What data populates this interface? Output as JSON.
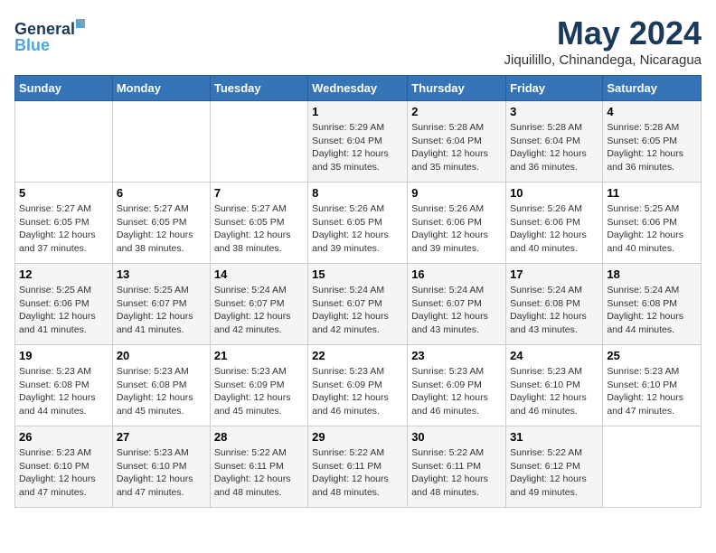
{
  "logo": {
    "part1": "General",
    "part2": "Blue"
  },
  "title": "May 2024",
  "location": "Jiquilillo, Chinandega, Nicaragua",
  "weekdays": [
    "Sunday",
    "Monday",
    "Tuesday",
    "Wednesday",
    "Thursday",
    "Friday",
    "Saturday"
  ],
  "weeks": [
    [
      {
        "day": "",
        "sunrise": "",
        "sunset": "",
        "daylight": ""
      },
      {
        "day": "",
        "sunrise": "",
        "sunset": "",
        "daylight": ""
      },
      {
        "day": "",
        "sunrise": "",
        "sunset": "",
        "daylight": ""
      },
      {
        "day": "1",
        "sunrise": "Sunrise: 5:29 AM",
        "sunset": "Sunset: 6:04 PM",
        "daylight": "Daylight: 12 hours and 35 minutes."
      },
      {
        "day": "2",
        "sunrise": "Sunrise: 5:28 AM",
        "sunset": "Sunset: 6:04 PM",
        "daylight": "Daylight: 12 hours and 35 minutes."
      },
      {
        "day": "3",
        "sunrise": "Sunrise: 5:28 AM",
        "sunset": "Sunset: 6:04 PM",
        "daylight": "Daylight: 12 hours and 36 minutes."
      },
      {
        "day": "4",
        "sunrise": "Sunrise: 5:28 AM",
        "sunset": "Sunset: 6:05 PM",
        "daylight": "Daylight: 12 hours and 36 minutes."
      }
    ],
    [
      {
        "day": "5",
        "sunrise": "Sunrise: 5:27 AM",
        "sunset": "Sunset: 6:05 PM",
        "daylight": "Daylight: 12 hours and 37 minutes."
      },
      {
        "day": "6",
        "sunrise": "Sunrise: 5:27 AM",
        "sunset": "Sunset: 6:05 PM",
        "daylight": "Daylight: 12 hours and 38 minutes."
      },
      {
        "day": "7",
        "sunrise": "Sunrise: 5:27 AM",
        "sunset": "Sunset: 6:05 PM",
        "daylight": "Daylight: 12 hours and 38 minutes."
      },
      {
        "day": "8",
        "sunrise": "Sunrise: 5:26 AM",
        "sunset": "Sunset: 6:05 PM",
        "daylight": "Daylight: 12 hours and 39 minutes."
      },
      {
        "day": "9",
        "sunrise": "Sunrise: 5:26 AM",
        "sunset": "Sunset: 6:06 PM",
        "daylight": "Daylight: 12 hours and 39 minutes."
      },
      {
        "day": "10",
        "sunrise": "Sunrise: 5:26 AM",
        "sunset": "Sunset: 6:06 PM",
        "daylight": "Daylight: 12 hours and 40 minutes."
      },
      {
        "day": "11",
        "sunrise": "Sunrise: 5:25 AM",
        "sunset": "Sunset: 6:06 PM",
        "daylight": "Daylight: 12 hours and 40 minutes."
      }
    ],
    [
      {
        "day": "12",
        "sunrise": "Sunrise: 5:25 AM",
        "sunset": "Sunset: 6:06 PM",
        "daylight": "Daylight: 12 hours and 41 minutes."
      },
      {
        "day": "13",
        "sunrise": "Sunrise: 5:25 AM",
        "sunset": "Sunset: 6:07 PM",
        "daylight": "Daylight: 12 hours and 41 minutes."
      },
      {
        "day": "14",
        "sunrise": "Sunrise: 5:24 AM",
        "sunset": "Sunset: 6:07 PM",
        "daylight": "Daylight: 12 hours and 42 minutes."
      },
      {
        "day": "15",
        "sunrise": "Sunrise: 5:24 AM",
        "sunset": "Sunset: 6:07 PM",
        "daylight": "Daylight: 12 hours and 42 minutes."
      },
      {
        "day": "16",
        "sunrise": "Sunrise: 5:24 AM",
        "sunset": "Sunset: 6:07 PM",
        "daylight": "Daylight: 12 hours and 43 minutes."
      },
      {
        "day": "17",
        "sunrise": "Sunrise: 5:24 AM",
        "sunset": "Sunset: 6:08 PM",
        "daylight": "Daylight: 12 hours and 43 minutes."
      },
      {
        "day": "18",
        "sunrise": "Sunrise: 5:24 AM",
        "sunset": "Sunset: 6:08 PM",
        "daylight": "Daylight: 12 hours and 44 minutes."
      }
    ],
    [
      {
        "day": "19",
        "sunrise": "Sunrise: 5:23 AM",
        "sunset": "Sunset: 6:08 PM",
        "daylight": "Daylight: 12 hours and 44 minutes."
      },
      {
        "day": "20",
        "sunrise": "Sunrise: 5:23 AM",
        "sunset": "Sunset: 6:08 PM",
        "daylight": "Daylight: 12 hours and 45 minutes."
      },
      {
        "day": "21",
        "sunrise": "Sunrise: 5:23 AM",
        "sunset": "Sunset: 6:09 PM",
        "daylight": "Daylight: 12 hours and 45 minutes."
      },
      {
        "day": "22",
        "sunrise": "Sunrise: 5:23 AM",
        "sunset": "Sunset: 6:09 PM",
        "daylight": "Daylight: 12 hours and 46 minutes."
      },
      {
        "day": "23",
        "sunrise": "Sunrise: 5:23 AM",
        "sunset": "Sunset: 6:09 PM",
        "daylight": "Daylight: 12 hours and 46 minutes."
      },
      {
        "day": "24",
        "sunrise": "Sunrise: 5:23 AM",
        "sunset": "Sunset: 6:10 PM",
        "daylight": "Daylight: 12 hours and 46 minutes."
      },
      {
        "day": "25",
        "sunrise": "Sunrise: 5:23 AM",
        "sunset": "Sunset: 6:10 PM",
        "daylight": "Daylight: 12 hours and 47 minutes."
      }
    ],
    [
      {
        "day": "26",
        "sunrise": "Sunrise: 5:23 AM",
        "sunset": "Sunset: 6:10 PM",
        "daylight": "Daylight: 12 hours and 47 minutes."
      },
      {
        "day": "27",
        "sunrise": "Sunrise: 5:23 AM",
        "sunset": "Sunset: 6:10 PM",
        "daylight": "Daylight: 12 hours and 47 minutes."
      },
      {
        "day": "28",
        "sunrise": "Sunrise: 5:22 AM",
        "sunset": "Sunset: 6:11 PM",
        "daylight": "Daylight: 12 hours and 48 minutes."
      },
      {
        "day": "29",
        "sunrise": "Sunrise: 5:22 AM",
        "sunset": "Sunset: 6:11 PM",
        "daylight": "Daylight: 12 hours and 48 minutes."
      },
      {
        "day": "30",
        "sunrise": "Sunrise: 5:22 AM",
        "sunset": "Sunset: 6:11 PM",
        "daylight": "Daylight: 12 hours and 48 minutes."
      },
      {
        "day": "31",
        "sunrise": "Sunrise: 5:22 AM",
        "sunset": "Sunset: 6:12 PM",
        "daylight": "Daylight: 12 hours and 49 minutes."
      },
      {
        "day": "",
        "sunrise": "",
        "sunset": "",
        "daylight": ""
      }
    ]
  ]
}
